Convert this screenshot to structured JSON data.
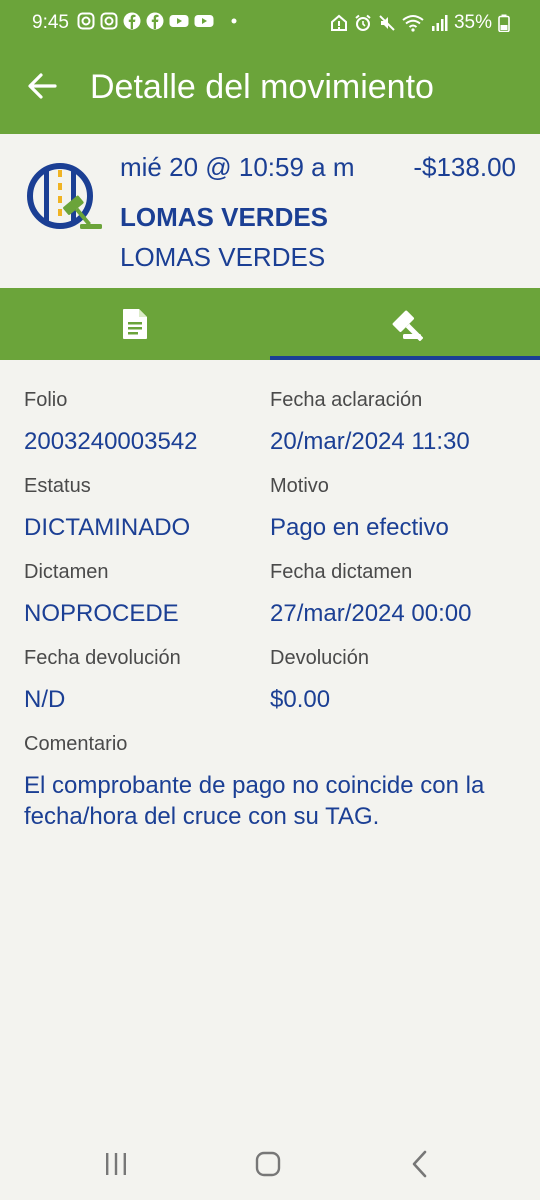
{
  "status_bar": {
    "time": "9:45",
    "battery": "35%",
    "left_icons": [
      "instagram-icon",
      "instagram-icon",
      "facebook-icon",
      "facebook-icon",
      "youtube-icon",
      "youtube-icon",
      "dot-icon"
    ],
    "right_icons": [
      "home-alert-icon",
      "alarm-icon",
      "mute-icon",
      "wifi-icon",
      "signal-icon",
      "battery-icon"
    ]
  },
  "app_bar": {
    "title": "Detalle del movimiento",
    "back_icon": "arrow-left-icon"
  },
  "movement": {
    "date": "mié 20 @ 10:59 a m",
    "amount": "-$138.00",
    "booth": "LOMAS VERDES",
    "location": "LOMAS VERDES",
    "icon": "toll-road-gavel-icon"
  },
  "tabs": [
    {
      "icon": "document-icon",
      "selected": false
    },
    {
      "icon": "gavel-icon",
      "selected": true
    }
  ],
  "details": {
    "folio_label": "Folio",
    "folio_value": "2003240003542",
    "fecha_aclaracion_label": "Fecha aclaración",
    "fecha_aclaracion_value": "20/mar/2024 11:30",
    "estatus_label": "Estatus",
    "estatus_value": "DICTAMINADO",
    "motivo_label": "Motivo",
    "motivo_value": "Pago en efectivo",
    "dictamen_label": "Dictamen",
    "dictamen_value": "NOPROCEDE",
    "fecha_dictamen_label": "Fecha dictamen",
    "fecha_dictamen_value": "27/mar/2024 00:00",
    "fecha_devolucion_label": "Fecha devolución",
    "fecha_devolucion_value": "N/D",
    "devolucion_label": "Devolución",
    "devolucion_value": "$0.00",
    "comentario_label": "Comentario",
    "comentario_value": "El comprobante de pago no coincide con la fecha/hora del cruce con su TAG."
  },
  "colors": {
    "primary_green": "#6ba43a",
    "text_blue": "#1b3f94",
    "background": "#f3f3ef"
  }
}
